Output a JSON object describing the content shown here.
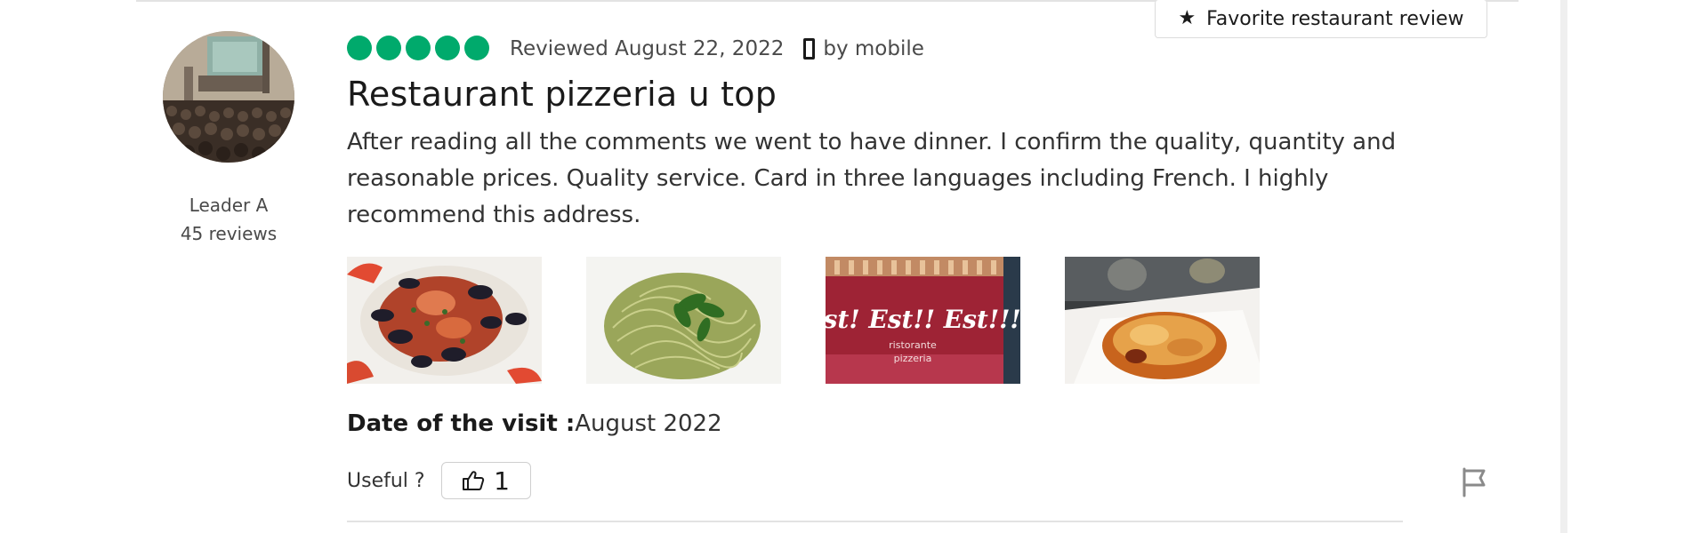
{
  "badge": {
    "icon": "star-icon",
    "label": "Favorite restaurant review"
  },
  "reviewer": {
    "name": "Leader A",
    "review_count": "45 reviews"
  },
  "review": {
    "rating": 5,
    "rating_max": 5,
    "rating_color": "#00aa6c",
    "reviewed_date": "Reviewed August 22, 2022",
    "device_icon": "mobile-phone-icon",
    "device_text": "by mobile",
    "title": "Restaurant pizzeria u top",
    "body": "After reading all the comments we went to have dinner. I confirm the quality, quantity and reasonable prices. Quality service. Card in three languages including French. I highly recommend this address.",
    "photos": [
      {
        "name": "seafood-pasta-photo"
      },
      {
        "name": "pesto-spaghetti-photo"
      },
      {
        "name": "restaurant-menu-card-photo",
        "texts": [
          "Est! Est!! Est!!!",
          "ristorante",
          "pizzeria"
        ]
      },
      {
        "name": "baked-dish-photo"
      }
    ],
    "visit_label": "Date of the visit :",
    "visit_value": "August 2022"
  },
  "actions": {
    "useful_label": "Useful ?",
    "useful_icon": "thumbs-up-icon",
    "useful_count": "1",
    "report_icon": "flag-icon"
  }
}
